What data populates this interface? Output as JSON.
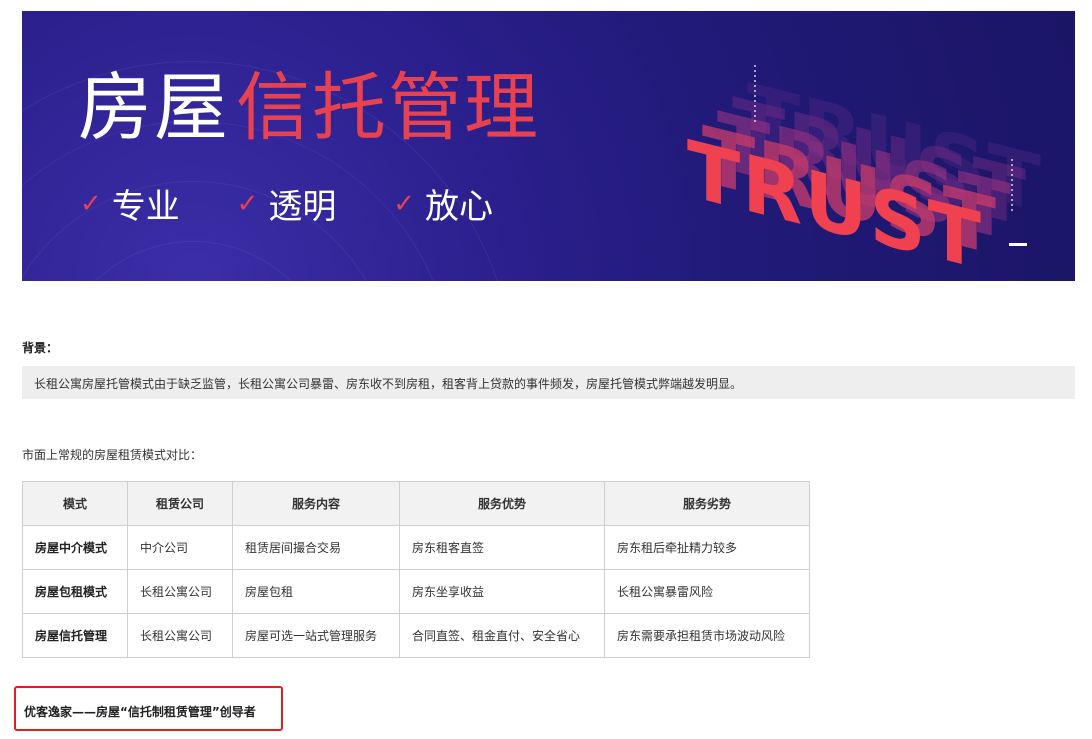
{
  "banner": {
    "title_white": "房屋",
    "title_red": "信托管理",
    "slogans": [
      "专业",
      "透明",
      "放心"
    ],
    "trust_word": "TRUST",
    "accent_color": "#e8414f",
    "bg_color": "#211a78"
  },
  "background": {
    "title": "背景：",
    "text": "长租公寓房屋托管模式由于缺乏监管，长租公寓公司暴雷、房东收不到房租，租客背上贷款的事件频发，房屋托管模式弊端越发明显。"
  },
  "compare": {
    "title": "市面上常规的房屋租赁模式对比：",
    "headers": [
      "模式",
      "租赁公司",
      "服务内容",
      "服务优势",
      "服务劣势"
    ],
    "rows": [
      [
        "房屋中介模式",
        "中介公司",
        "租赁居间撮合交易",
        "房东租客直签",
        "房东租后牵扯精力较多"
      ],
      [
        "房屋包租模式",
        "长租公寓公司",
        "房屋包租",
        "房东坐享收益",
        "长租公寓暴雷风险"
      ],
      [
        "房屋信托管理",
        "长租公寓公司",
        "房屋可选一站式管理服务",
        "合同直签、租金直付、安全省心",
        "房东需要承担租赁市场波动风险"
      ]
    ]
  },
  "highlight": {
    "text": "优客逸家——房屋“信托制租赁管理”创导者",
    "border_color": "#e01f22"
  }
}
